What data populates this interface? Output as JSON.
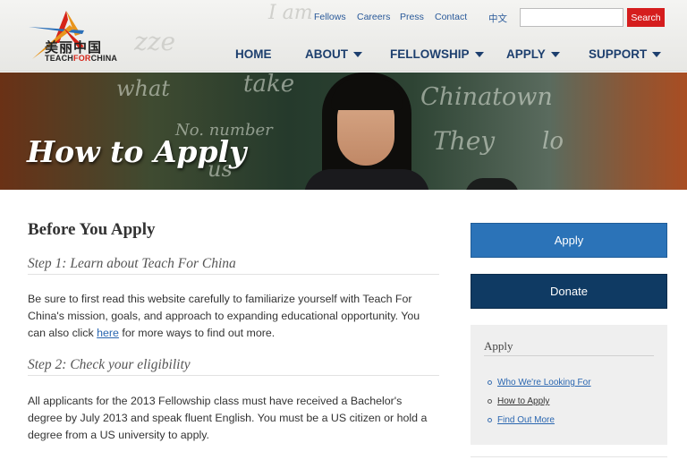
{
  "header": {
    "logo": {
      "cn": "美丽中国",
      "en_pre": "TEACH",
      "en_for": "FOR",
      "en_post": "CHINA"
    },
    "chalk": {
      "a": "I am",
      "b": "zze"
    },
    "utility_nav": [
      "Fellows",
      "Careers",
      "Press",
      "Contact",
      "中文"
    ],
    "search": {
      "placeholder": "",
      "button_label": "Search"
    },
    "main_nav": [
      {
        "label": "HOME",
        "dropdown": false
      },
      {
        "label": "ABOUT",
        "dropdown": true
      },
      {
        "label": "FELLOWSHIP",
        "dropdown": true
      },
      {
        "label": "APPLY",
        "dropdown": true
      },
      {
        "label": "SUPPORT",
        "dropdown": true
      }
    ]
  },
  "hero": {
    "title": "How to Apply",
    "chalkboard": {
      "w1": "take",
      "w2": "what",
      "w3": "No. number",
      "w4": "Chinatown",
      "w5": "They",
      "w6": "lo",
      "w7": "us"
    }
  },
  "content": {
    "heading": "Before You Apply",
    "step1": {
      "title": "Step 1: Learn about Teach For China",
      "text_before_link": "Be sure to first read this website carefully to familiarize yourself with Teach For China's mission, goals, and approach to expanding educational opportunity. You can also click ",
      "link": "here",
      "text_after_link": " for more ways to find out more."
    },
    "step2": {
      "title": "Step 2: Check your eligibility",
      "text": "All applicants for the 2013 Fellowship class must have received a Bachelor's degree by July 2013 and speak fluent English. You must be a US citizen or hold a degree from a US university to apply."
    }
  },
  "sidebar": {
    "apply_button": "Apply",
    "donate_button": "Donate",
    "box_title": "Apply",
    "links": [
      {
        "label": "Who We're Looking For",
        "current": false
      },
      {
        "label": "How to Apply",
        "current": true
      },
      {
        "label": "Find Out More",
        "current": false
      }
    ]
  },
  "colors": {
    "nav_text": "#1d3f6e",
    "link": "#2a66b0",
    "search_button": "#d51d1d",
    "apply_button": "#2b73b8",
    "donate_button": "#0f3a63"
  }
}
